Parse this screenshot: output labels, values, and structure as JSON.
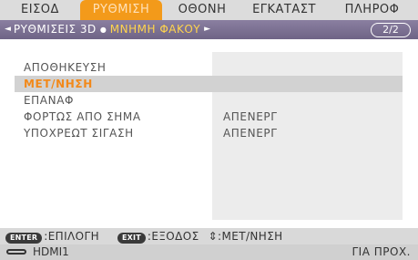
{
  "tabs": [
    {
      "label": "ΕΙΣΟΔ",
      "active": false
    },
    {
      "label": "ΡΥΘΜΙΣΗ",
      "active": true
    },
    {
      "label": "ΟΘΟΝΗ",
      "active": false
    },
    {
      "label": "ΕΓΚΑΤΑΣΤ",
      "active": false
    },
    {
      "label": "ΠΛΗΡΟΦ",
      "active": false
    }
  ],
  "breadcrumb": {
    "left_arrow": "◄",
    "section": "ΡΥΘΜΙΣΕΙΣ 3D",
    "separator": "●",
    "current": "ΜΝΗΜΗ ΦΑΚΟΥ",
    "right_arrow": "►",
    "page": "2/2"
  },
  "menu": {
    "items": [
      {
        "label": "ΑΠΟΘΗΚΕΥΣΗ",
        "value": ""
      },
      {
        "label": "ΜΕΤ/ΝΗΣΗ",
        "value": "",
        "selected": true
      },
      {
        "label": "ΕΠΑΝΑΦ",
        "value": ""
      },
      {
        "label": "ΦΟΡΤΩΣ ΑΠΟ ΣΗΜΑ",
        "value": "ΑΠΕΝΕΡΓ"
      },
      {
        "label": "ΥΠΟΧΡΕΩΤ ΣΙΓΑΣΗ",
        "value": "ΑΠΕΝΕΡΓ"
      }
    ]
  },
  "footer": {
    "enter_key": "ENTER",
    "enter_text": ":ΕΠΙΛΟΓΗ",
    "exit_key": "EXIT",
    "exit_text": ":ΕΞΟΔΟΣ",
    "move_text": "⇕:ΜΕΤ/ΝΗΣΗ"
  },
  "status": {
    "source_icon": "hdmi-icon",
    "source": "HDMI1",
    "help": "ΓΙΑ ΠΡΟΧ."
  },
  "colors": {
    "active_tab": "#f39a1a",
    "selected_text": "#f2891a",
    "breadcrumb_current": "#ffd44d"
  }
}
